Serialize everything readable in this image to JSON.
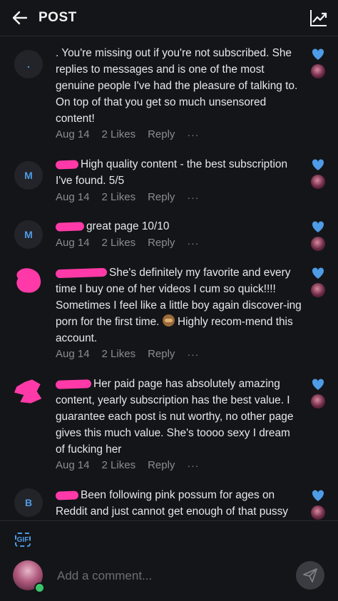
{
  "header": {
    "title": "POST"
  },
  "comments": [
    {
      "avatar_letter": ".",
      "text": ". You're missing out if you're not subscribed. She replies to messages and is one of the most genuine people I've had the pleasure of talking to. On top of that you get so much unsensored content!",
      "date": "Aug 14",
      "likes": "2 Likes",
      "reply": "Reply",
      "more": "···"
    },
    {
      "avatar_letter": "M",
      "text": "High quality content - the best subscription I've found. 5/5",
      "date": "Aug 14",
      "likes": "2 Likes",
      "reply": "Reply",
      "more": "···"
    },
    {
      "avatar_letter": "M",
      "text": "great page 10/10",
      "date": "Aug 14",
      "likes": "2 Likes",
      "reply": "Reply",
      "more": "···"
    },
    {
      "avatar_letter": "",
      "text_a": "She's definitely my favorite and every time I buy one of her videos I cum so quick!!!! Sometimes I feel like a little boy again discover-ing porn for the first time.",
      "text_b": "Highly recom-mend this account.",
      "date": "Aug 14",
      "likes": "2 Likes",
      "reply": "Reply",
      "more": "···"
    },
    {
      "avatar_letter": "",
      "text": "Her paid page has absolutely amazing content, yearly subscription has the best value. I guarantee each post is nut worthy, no other page gives this much value. She's toooo sexy I dream of fucking her",
      "date": "Aug 14",
      "likes": "2 Likes",
      "reply": "Reply",
      "more": "···"
    },
    {
      "avatar_letter": "B",
      "text": "Been following pink possum for ages on Reddit and just cannot get enough of that pussy"
    }
  ],
  "composer": {
    "gif_label": "GIF",
    "placeholder": "Add a comment..."
  },
  "colors": {
    "accent": "#4e9be6",
    "redaction": "#ff3aa8",
    "background": "#141518"
  }
}
